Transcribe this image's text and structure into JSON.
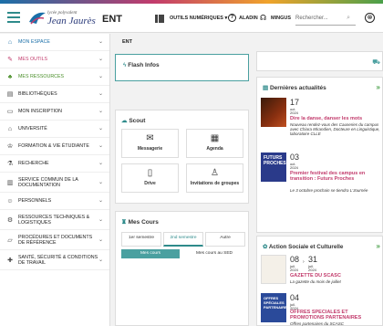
{
  "header": {
    "brand_small": "lycée polyvalent",
    "brand_name": "Jean Jaurès",
    "brand_ent": "ENT",
    "tools_label": "OUTILS NUMÉRIQUES ▾",
    "aladin_label": "ALADIN",
    "user_label": "MINGUS",
    "search_placeholder": "Rechercher..."
  },
  "sidebar": {
    "items": [
      {
        "label": "MON ESPACE",
        "icon": "home-icon",
        "color": "#1a6fa8"
      },
      {
        "label": "MES OUTILS",
        "icon": "wrench-icon",
        "color": "#c23b6c"
      },
      {
        "label": "MES RESSOURCES",
        "icon": "people-icon",
        "color": "#4a8f2a"
      },
      {
        "label": "BIBLIOTHÈQUES",
        "icon": "book-icon"
      },
      {
        "label": "MON INSCRIPTION",
        "icon": "id-card-icon"
      },
      {
        "label": "UNIVERSITÉ",
        "icon": "building-icon"
      },
      {
        "label": "FORMATION & VIE ÉTUDIANTE",
        "icon": "graduation-icon"
      },
      {
        "label": "RECHERCHE",
        "icon": "flask-icon"
      },
      {
        "label": "SERVICE COMMUN DE LA DOCUMENTATION",
        "icon": "library-icon"
      },
      {
        "label": "PERSONNELS",
        "icon": "staff-icon"
      },
      {
        "label": "RESSOURCES TECHNIQUES & LOGISTIQUES",
        "icon": "tools-icon"
      },
      {
        "label": "PROCÉDURES ET DOCUMENTS DE RÉFÉRENCE",
        "icon": "folder-icon"
      },
      {
        "label": "SANTÉ, SÉCURITÉ & CONDITIONS DE TRAVAIL",
        "icon": "health-icon"
      }
    ]
  },
  "main": {
    "ent_label": "ENT",
    "flash_title": "Flash Infos",
    "scout_title": "Scout",
    "tiles": [
      "Messagerie",
      "Agenda",
      "Drive",
      "Invitations de groupes"
    ],
    "cours_title": "Mes Cours",
    "semesters": [
      "1er semestre",
      "2nd semestre",
      "Autre"
    ],
    "subtabs": [
      "Mes cours",
      "Mes cours au SED"
    ]
  },
  "actualites": {
    "title": "Dernières actualités",
    "items": [
      {
        "day": "17",
        "month": "oct.",
        "year": "2024",
        "title": "Dire la danse, danser les mots",
        "desc": "Nouveau rendez-vous des Causeries du campus avec Chiara Mirandien, Docteure en Linguistique, laboratoire CLLE"
      },
      {
        "day": "03",
        "month": "oct.",
        "year": "2024",
        "title": "Premier festival des campus en transition : Futurs Proches",
        "desc": "Le 3 octobre prochain se tiendra L'Journée"
      }
    ]
  },
  "social": {
    "title": "Action Sociale et Culturelle",
    "items": [
      {
        "day": "08",
        "day2": "31",
        "month": "juil.",
        "month2": "juil.",
        "year": "2024",
        "year2": "2024",
        "title": "GAZETTE DU SCASC",
        "desc": "La gazette du mois de juillet"
      },
      {
        "day": "04",
        "month": "juil.",
        "year": "2024",
        "title": "OFFRES SPECIALES ET PROMOTIONS PARTENAIRES",
        "desc": "Offres partenaires du SCASC"
      }
    ]
  }
}
